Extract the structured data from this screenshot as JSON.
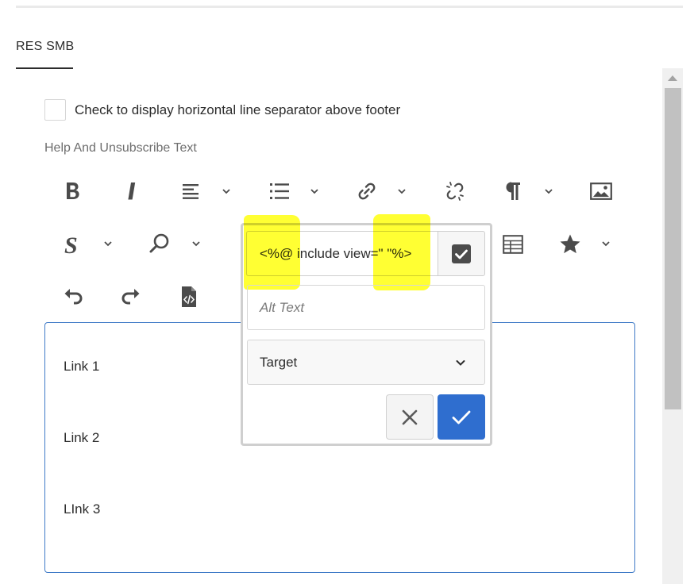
{
  "tab": {
    "label": "RES SMB"
  },
  "separator_option": {
    "label": "Check to display horizontal line separator above footer",
    "checked": false
  },
  "field_label": "Help And Unsubscribe Text",
  "toolbar": {
    "row1": [
      "bold-icon",
      "italic-icon",
      "align-icon",
      "list-icon",
      "link-icon",
      "unlink-icon",
      "paragraph-icon",
      "image-icon"
    ],
    "row2": [
      "styles-icon",
      "search-icon",
      "table-icon",
      "special-character-icon"
    ],
    "row3": [
      "undo-icon",
      "redo-icon",
      "source-code-icon"
    ]
  },
  "editor": {
    "lines": [
      "Link 1",
      "Link 2",
      "LInk 3"
    ]
  },
  "link_dialog": {
    "path_value": "<%@ include view=\" \"%>",
    "alt_text_placeholder": "Alt Text",
    "target_label": "Target",
    "highlight_color": "#ffff00",
    "confirm_color": "#2f6ecf"
  }
}
